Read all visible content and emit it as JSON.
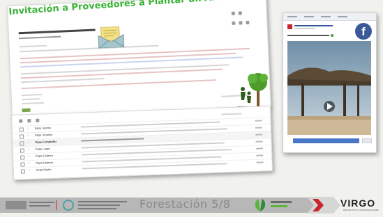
{
  "email": {
    "heading": "Invitación a Proveedores a Plantar un Árbol"
  },
  "inbox_rows": [
    {
      "sender": "Pepe Jacinto"
    },
    {
      "sender": "Pepe Jiménez"
    },
    {
      "sender": "Pepe Fernández"
    },
    {
      "sender": "Pepe López"
    },
    {
      "sender": "Pepe Cabrera"
    },
    {
      "sender": "Pepe Romero"
    },
    {
      "sender": "Pepe Martín"
    }
  ],
  "footer": {
    "forestacion": "Forestación 5/8",
    "virgo": "VIRGO",
    "virgo_sub": "PROYECTOS Y CONSTRUCCIONES"
  },
  "colors": {
    "heading_green": "#37b233",
    "facebook_blue": "#3b5998",
    "virgo_red": "#c8252c"
  }
}
